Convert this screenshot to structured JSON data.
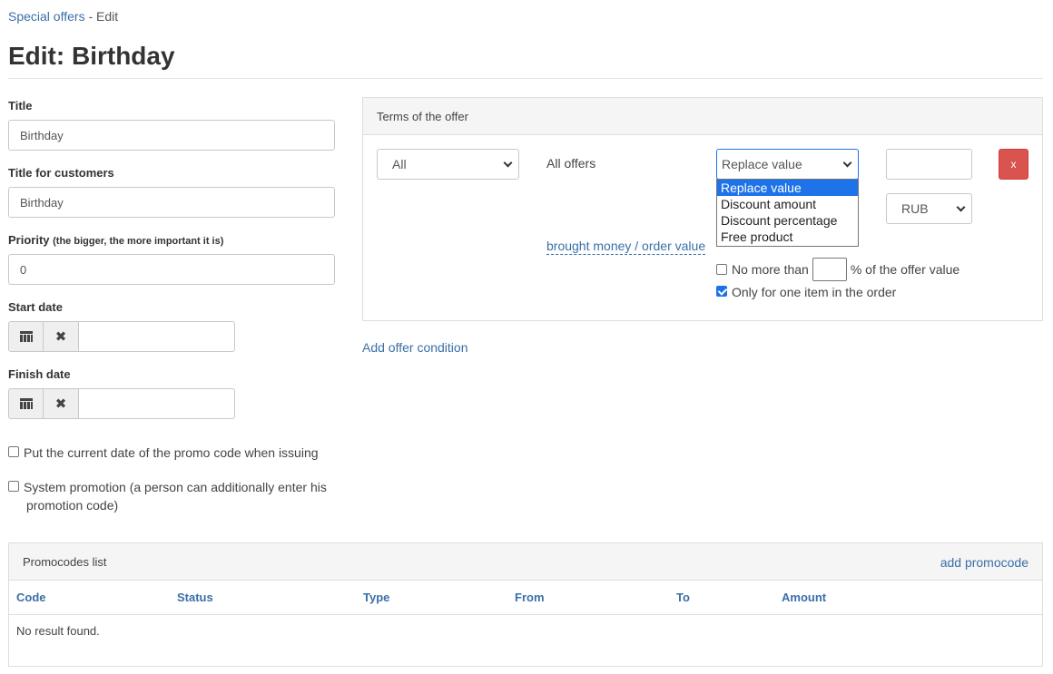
{
  "breadcrumb": {
    "parent": "Special offers",
    "separator": "-",
    "current": "Edit"
  },
  "page_title": "Edit: Birthday",
  "form": {
    "title_label": "Title",
    "title_value": "Birthday",
    "customer_title_label": "Title for customers",
    "customer_title_value": "Birthday",
    "priority_label": "Priority",
    "priority_hint": "(the bigger, the more important it is)",
    "priority_value": "0",
    "start_date_label": "Start date",
    "finish_date_label": "Finish date",
    "current_date_check": "Put the current date of the promo code when issuing",
    "system_promo_check_line1": "System promotion (a person can additionally enter his",
    "system_promo_check_line2": "promotion code)"
  },
  "terms": {
    "heading": "Terms of the offer",
    "scope_select": "All",
    "offers_text": "All offers",
    "action_select": "Replace value",
    "action_options": [
      "Replace value",
      "Discount amount",
      "Discount percentage",
      "Free product"
    ],
    "currency_select": "RUB",
    "delete_label": "x",
    "brought_link": "brought money / order value",
    "no_more_than": "No more than",
    "percent_text": "% of the offer value",
    "one_item": "Only for one item in the order",
    "add_condition": "Add offer condition"
  },
  "promocodes": {
    "heading": "Promocodes list",
    "add_link": "add promocode",
    "columns": [
      "Code",
      "Status",
      "Type",
      "From",
      "To",
      "Amount"
    ],
    "empty": "No result found."
  },
  "colors": {
    "link": "#3a6fa8",
    "danger": "#d9534f",
    "selected": "#1e73e8"
  }
}
